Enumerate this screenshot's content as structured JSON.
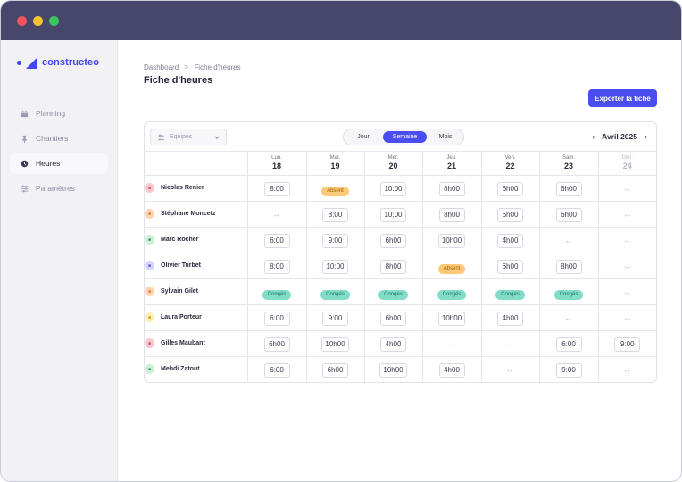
{
  "app": {
    "logo_text": "constructeo",
    "accent": "#4a4df0"
  },
  "sidebar": {
    "items": [
      {
        "label": "Planning",
        "icon": "calendar-icon",
        "active": false
      },
      {
        "label": "Chantiers",
        "icon": "pin-icon",
        "active": false
      },
      {
        "label": "Heures",
        "icon": "clock-icon",
        "active": true
      },
      {
        "label": "Paramètres",
        "icon": "sliders-icon",
        "active": false
      }
    ]
  },
  "breadcrumb": {
    "root": "Dashboard",
    "separator": ">",
    "current": "Fiche d'heures"
  },
  "page": {
    "title": "Fiche d'heures",
    "export_label": "Exporter la fiche"
  },
  "toolbar": {
    "team_placeholder": "Equipes",
    "views": [
      "Jour",
      "Semaine",
      "Mois"
    ],
    "active_view": "Semaine",
    "month_label": "Avril 2025",
    "prev_arrow": "‹",
    "next_arrow": "›"
  },
  "days": [
    {
      "name": "Lun.",
      "num": "18",
      "muted": false
    },
    {
      "name": "Mar.",
      "num": "19",
      "muted": false
    },
    {
      "name": "Mer.",
      "num": "20",
      "muted": false
    },
    {
      "name": "Jeu.",
      "num": "21",
      "muted": false
    },
    {
      "name": "Ven.",
      "num": "22",
      "muted": false
    },
    {
      "name": "Sam.",
      "num": "23",
      "muted": false
    },
    {
      "name": "Dim.",
      "num": "24",
      "muted": true
    }
  ],
  "status_colors": {
    "absent": "#ffc978",
    "conge": "#82dcc8"
  },
  "employees": [
    {
      "name": "Nicolas Renier",
      "avatar_color": "#f7c9cf",
      "avatar_fg": "#d2505e",
      "cells": [
        {
          "type": "time",
          "value": "8:00"
        },
        {
          "type": "absent",
          "value": "Absent"
        },
        {
          "type": "time",
          "value": "10:00"
        },
        {
          "type": "time",
          "value": "8h00"
        },
        {
          "type": "time",
          "value": "6h00"
        },
        {
          "type": "time",
          "value": "6h00"
        },
        {
          "type": "empty",
          "value": "--"
        }
      ]
    },
    {
      "name": "Stéphane Moncetz",
      "avatar_color": "#ffd5b4",
      "avatar_fg": "#d47a2c",
      "cells": [
        {
          "type": "empty",
          "value": "--"
        },
        {
          "type": "time",
          "value": "8:00"
        },
        {
          "type": "time",
          "value": "10:00"
        },
        {
          "type": "time",
          "value": "8h00"
        },
        {
          "type": "time",
          "value": "6h00"
        },
        {
          "type": "time",
          "value": "6h00"
        },
        {
          "type": "empty",
          "value": "--"
        }
      ]
    },
    {
      "name": "Marc Rocher",
      "avatar_color": "#cdf1d7",
      "avatar_fg": "#2f9a52",
      "cells": [
        {
          "type": "time",
          "value": "6:00"
        },
        {
          "type": "time",
          "value": "9:00"
        },
        {
          "type": "time",
          "value": "6h00"
        },
        {
          "type": "time",
          "value": "10h00"
        },
        {
          "type": "time",
          "value": "4h00"
        },
        {
          "type": "empty",
          "value": "--"
        },
        {
          "type": "empty",
          "value": "--"
        }
      ]
    },
    {
      "name": "Olivier Turbet",
      "avatar_color": "#d8d7fb",
      "avatar_fg": "#5a56d6",
      "cells": [
        {
          "type": "time",
          "value": "8:00"
        },
        {
          "type": "time",
          "value": "10:00"
        },
        {
          "type": "time",
          "value": "8h00"
        },
        {
          "type": "absent",
          "value": "Absent"
        },
        {
          "type": "time",
          "value": "6h00"
        },
        {
          "type": "time",
          "value": "8h00"
        },
        {
          "type": "empty",
          "value": "--"
        }
      ]
    },
    {
      "name": "Sylvain Gilet",
      "avatar_color": "#ffd5b4",
      "avatar_fg": "#d47a2c",
      "cells": [
        {
          "type": "conge",
          "value": "Congés"
        },
        {
          "type": "conge",
          "value": "Congés"
        },
        {
          "type": "conge",
          "value": "Congés"
        },
        {
          "type": "conge",
          "value": "Congés"
        },
        {
          "type": "conge",
          "value": "Congés"
        },
        {
          "type": "conge",
          "value": "Congés"
        },
        {
          "type": "empty",
          "value": "--"
        }
      ]
    },
    {
      "name": "Laura Porteur",
      "avatar_color": "#fff0b8",
      "avatar_fg": "#c49a12",
      "cells": [
        {
          "type": "time",
          "value": "6:00"
        },
        {
          "type": "time",
          "value": "9:00"
        },
        {
          "type": "time",
          "value": "6h00"
        },
        {
          "type": "time",
          "value": "10h00"
        },
        {
          "type": "time",
          "value": "4h00"
        },
        {
          "type": "empty",
          "value": "--"
        },
        {
          "type": "empty",
          "value": "--"
        }
      ]
    },
    {
      "name": "Gilles Maubant",
      "avatar_color": "#f7c9cf",
      "avatar_fg": "#d2505e",
      "cells": [
        {
          "type": "time",
          "value": "6h00"
        },
        {
          "type": "time",
          "value": "10h00"
        },
        {
          "type": "time",
          "value": "4h00"
        },
        {
          "type": "empty",
          "value": "--"
        },
        {
          "type": "empty",
          "value": "--"
        },
        {
          "type": "time",
          "value": "6:00"
        },
        {
          "type": "time",
          "value": "9:00"
        }
      ]
    },
    {
      "name": "Mehdi Zatout",
      "avatar_color": "#cdf1d7",
      "avatar_fg": "#2f9a52",
      "cells": [
        {
          "type": "time",
          "value": "6:00"
        },
        {
          "type": "time",
          "value": "6h00"
        },
        {
          "type": "time",
          "value": "10h00"
        },
        {
          "type": "time",
          "value": "4h00"
        },
        {
          "type": "empty",
          "value": "--"
        },
        {
          "type": "time",
          "value": "9:00"
        },
        {
          "type": "empty",
          "value": "--"
        }
      ]
    }
  ]
}
